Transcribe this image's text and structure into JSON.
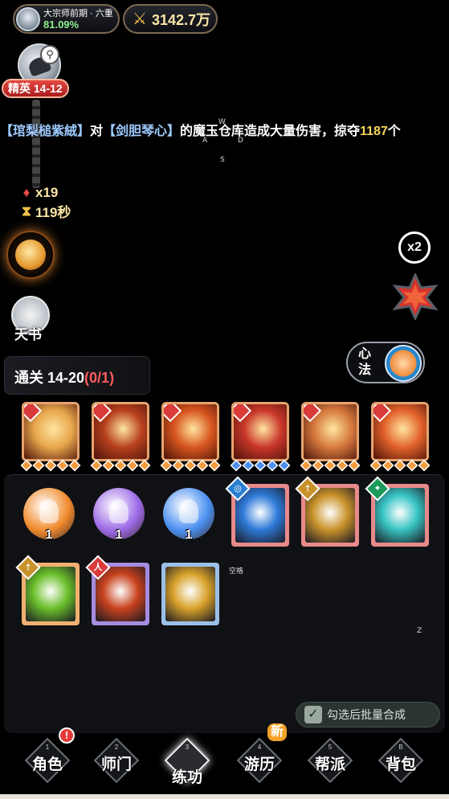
{
  "header": {
    "rank_title": "大宗师前期 · 六重",
    "rank_percent": "81.09%",
    "combat_power": "3142.7万"
  },
  "stage": {
    "tag": "精英 14-12"
  },
  "broadcast": {
    "name1": "【琯梨槌紫絨】",
    "text1": "对",
    "name2": "【剑胆琴心】",
    "text2": "的魔玉仓库造成大量伤害，掠夺",
    "amount": "1187",
    "text3": "个"
  },
  "key_hints": {
    "w": "W",
    "a": "A",
    "d": "D",
    "s": "S",
    "space": "空格",
    "z": "Z"
  },
  "counters": {
    "kills": "x19",
    "timer": "119秒"
  },
  "side": {
    "book_label": "天书",
    "speed": "x2"
  },
  "quest": {
    "label": "通关 14-20",
    "progress": "(0/1)"
  },
  "xinfa": {
    "label": "心法"
  },
  "equipped_skills": [
    {
      "art": "#e8a64c",
      "stars": "orange"
    },
    {
      "art": "#b8401e",
      "stars": "orange"
    },
    {
      "art": "#d8561f",
      "stars": "orange"
    },
    {
      "art": "#c9362a",
      "stars": "blue"
    },
    {
      "art": "#d77a3f",
      "stars": "orange"
    },
    {
      "art": "#e2622a",
      "stars": "orange"
    }
  ],
  "bag": {
    "orbs": [
      {
        "count": "1",
        "color": "#f08a2c"
      },
      {
        "count": "1",
        "color": "#9b6ae6"
      },
      {
        "count": "1",
        "color": "#4a8ff0"
      }
    ],
    "batch_label": "勾选后批量合成"
  },
  "nav": {
    "items": [
      {
        "num": "1",
        "label": "角色"
      },
      {
        "num": "2",
        "label": "师门"
      },
      {
        "num": "3",
        "label": "练功"
      },
      {
        "num": "4",
        "label": "游历"
      },
      {
        "num": "5",
        "label": "帮派"
      },
      {
        "num": "B",
        "label": "背包"
      }
    ],
    "alert": "!",
    "new_badge": "新"
  }
}
